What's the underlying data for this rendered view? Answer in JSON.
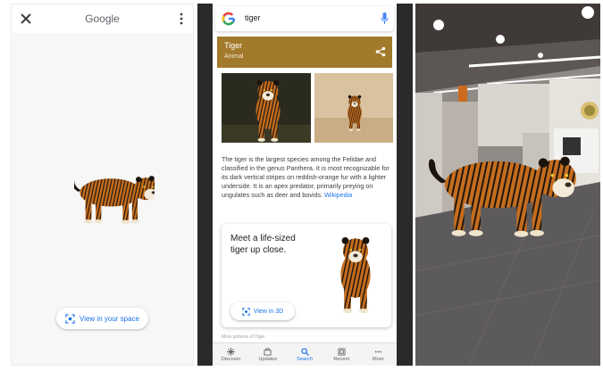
{
  "panel1": {
    "app_title": "Google",
    "close_icon": "close-icon",
    "more_icon": "more-vert-icon",
    "view_in_space_label": "View in your space",
    "ar_icon": "ar-view-icon"
  },
  "panel2": {
    "search": {
      "query": "tiger",
      "logo_icon": "google-g-icon",
      "mic_icon": "microphone-icon"
    },
    "card": {
      "title": "Tiger",
      "subtitle": "Animal",
      "share_icon": "share-icon"
    },
    "description": "The tiger is the largest species among the Felidae and classified in the genus Panthera. It is most recognizable for its dark vertical stripes on reddish-orange fur with a lighter underside. It is an apex predator, primarily preying on ungulates such as deer and bovids.",
    "wiki_link": "Wikipedia",
    "life_sized": {
      "text": "Meet a life-sized tiger up close.",
      "button_label": "View in 3D"
    },
    "peek_text": "More pictures of Tiger",
    "bottom_nav": [
      {
        "label": "Discover",
        "icon": "discover-icon",
        "active": false
      },
      {
        "label": "Updates",
        "icon": "updates-icon",
        "active": false
      },
      {
        "label": "Search",
        "icon": "search-icon",
        "active": true
      },
      {
        "label": "Recent",
        "icon": "recent-icon",
        "active": false
      },
      {
        "label": "More",
        "icon": "more-horiz-icon",
        "active": false
      }
    ]
  },
  "colors": {
    "accent": "#1a73e8",
    "card_header": "#a27a2b",
    "tiger_orange": "#c46d1d"
  }
}
